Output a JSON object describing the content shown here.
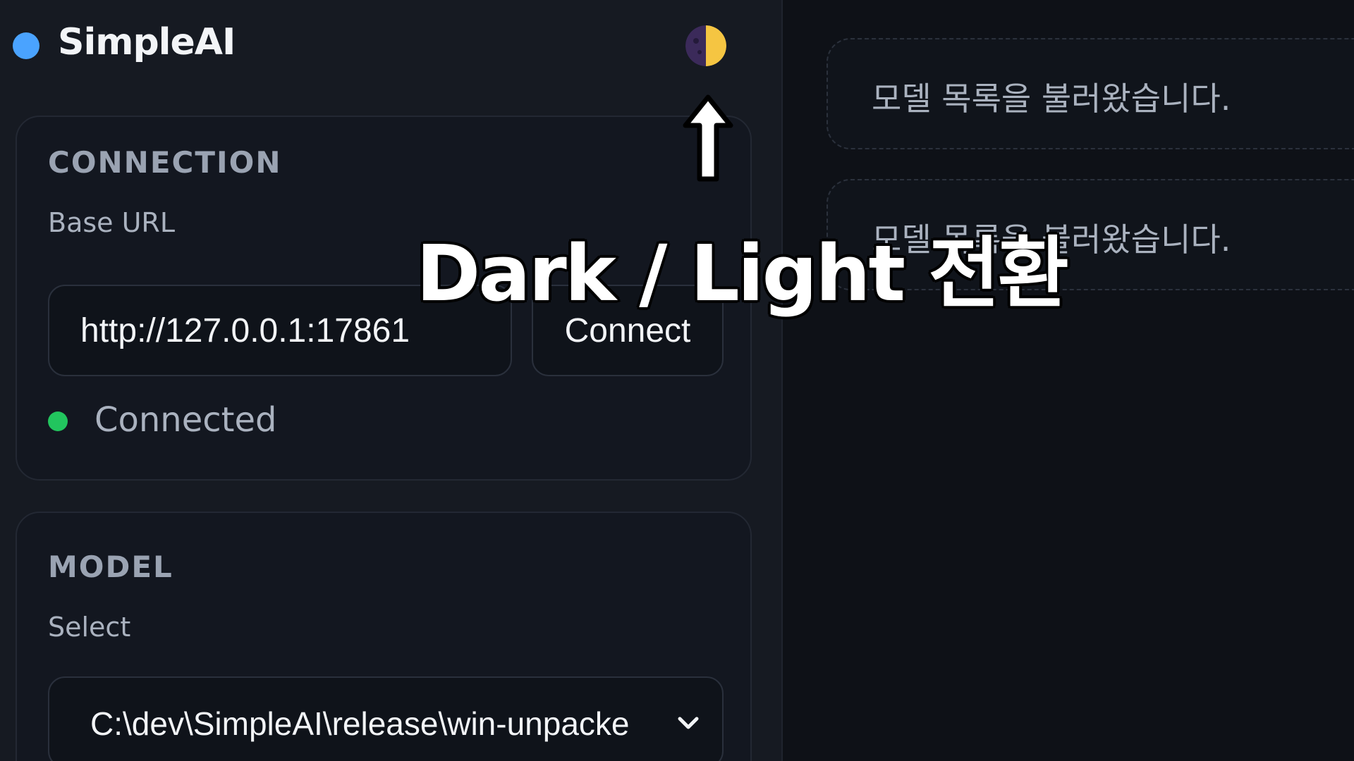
{
  "app": {
    "name": "SimpleAI",
    "accent_color": "#4aa3ff"
  },
  "theme_toggle": {
    "icon": "half-moon-icon",
    "dark_color": "#3b2a5a",
    "light_color": "#f5c542"
  },
  "connection": {
    "section_title": "CONNECTION",
    "base_url_label": "Base URL",
    "base_url_value": "http://127.0.0.1:17861",
    "connect_label": "Connect",
    "status_text": "Connected",
    "status_color": "#22c55e"
  },
  "model": {
    "section_title": "MODEL",
    "select_label": "Select",
    "selected_value": "C:\\dev\\SimpleAI\\release\\win-unpacke",
    "chevron_icon": "chevron-down-icon"
  },
  "notifications": [
    {
      "text": "모델 목록을 불러왔습니다."
    },
    {
      "text": "모델 목록을 불러왔습니다."
    }
  ],
  "annotation": {
    "text": "Dark / Light 전환",
    "arrow_icon": "arrow-up-icon"
  }
}
